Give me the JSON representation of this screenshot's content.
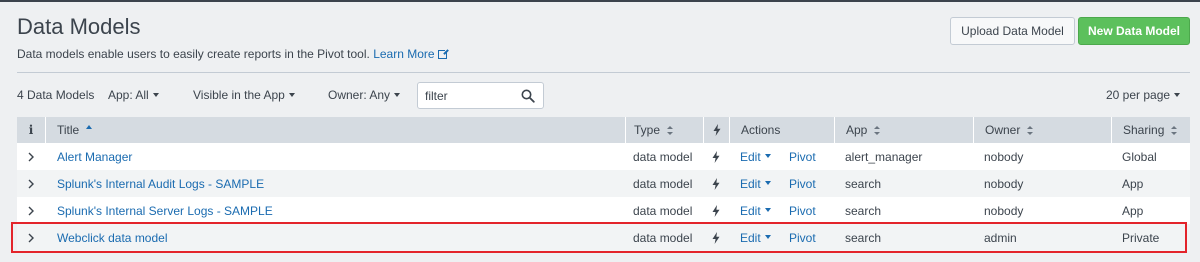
{
  "header": {
    "title": "Data Models",
    "subtitle": "Data models enable users to easily create reports in the Pivot tool.",
    "learn_more": "Learn More",
    "upload_button": "Upload Data Model",
    "new_button": "New Data Model"
  },
  "toolbar": {
    "count": "4 Data Models",
    "app_filter": "App: All",
    "visible_filter": "Visible in the App",
    "owner_filter": "Owner: Any",
    "filter_placeholder": "filter",
    "per_page": "20 per page"
  },
  "table": {
    "columns": {
      "info": "i",
      "title": "Title",
      "type": "Type",
      "actions": "Actions",
      "app": "App",
      "owner": "Owner",
      "sharing": "Sharing"
    },
    "rows": [
      {
        "title": "Alert Manager",
        "type": "data model",
        "edit": "Edit",
        "pivot": "Pivot",
        "app": "alert_manager",
        "owner": "nobody",
        "sharing": "Global"
      },
      {
        "title": "Splunk's Internal Audit Logs - SAMPLE",
        "type": "data model",
        "edit": "Edit",
        "pivot": "Pivot",
        "app": "search",
        "owner": "nobody",
        "sharing": "App"
      },
      {
        "title": "Splunk's Internal Server Logs - SAMPLE",
        "type": "data model",
        "edit": "Edit",
        "pivot": "Pivot",
        "app": "search",
        "owner": "nobody",
        "sharing": "App"
      },
      {
        "title": "Webclick data model",
        "type": "data model",
        "edit": "Edit",
        "pivot": "Pivot",
        "app": "search",
        "owner": "admin",
        "sharing": "Private"
      }
    ]
  },
  "colors": {
    "accent_link": "#1a6bb0",
    "primary_button": "#5cc05c",
    "highlight_border": "#e3242b"
  },
  "icons": [
    "external-link-icon",
    "search-icon",
    "sort-icon",
    "lightning-icon",
    "chevron-right-icon",
    "caret-down-icon"
  ]
}
